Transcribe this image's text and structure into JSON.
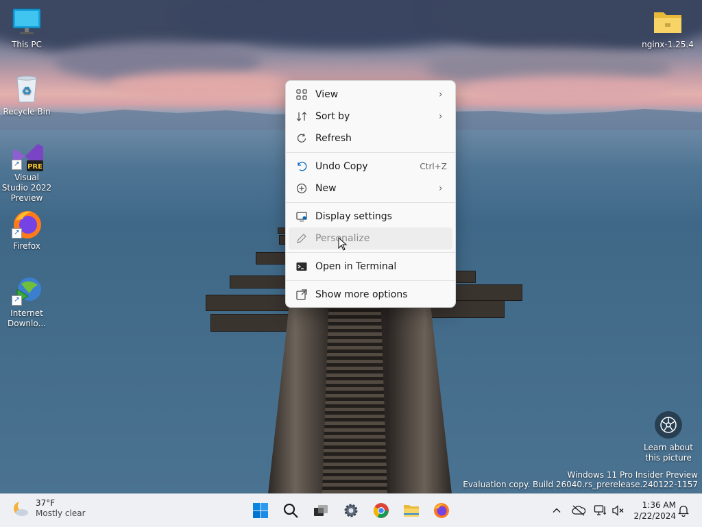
{
  "desktop": {
    "icons": [
      {
        "label": "This PC"
      },
      {
        "label": "Recycle Bin"
      },
      {
        "label": "Visual Studio 2022 Preview",
        "badge": "PRE"
      },
      {
        "label": "Firefox"
      },
      {
        "label": "Internet Downlo..."
      },
      {
        "label": "nginx-1.25.4"
      }
    ],
    "learn_picture": "Learn about this picture",
    "watermark": {
      "line1": "Windows 11 Pro Insider Preview",
      "line2": "Evaluation copy. Build 26040.rs_prerelease.240122-1157"
    }
  },
  "context_menu": {
    "items": [
      {
        "label": "View",
        "icon": "grid-icon",
        "submenu": true
      },
      {
        "label": "Sort by",
        "icon": "sort-icon",
        "submenu": true
      },
      {
        "label": "Refresh",
        "icon": "refresh-icon"
      },
      {
        "label": "Undo Copy",
        "icon": "undo-icon",
        "shortcut": "Ctrl+Z"
      },
      {
        "label": "New",
        "icon": "plus-circle-icon",
        "submenu": true
      },
      {
        "label": "Display settings",
        "icon": "display-icon"
      },
      {
        "label": "Personalize",
        "icon": "pen-icon",
        "state": "hover"
      },
      {
        "label": "Open in Terminal",
        "icon": "terminal-icon"
      },
      {
        "label": "Show more options",
        "icon": "expand-icon"
      }
    ]
  },
  "taskbar": {
    "weather": {
      "temp": "37°F",
      "condition": "Mostly clear"
    },
    "apps": [
      "start-icon",
      "search-icon",
      "task-view-icon",
      "settings-icon",
      "chrome-icon",
      "file-explorer-icon",
      "firefox-icon"
    ],
    "tray": [
      "chevron-up-icon",
      "onedrive-offline-icon",
      "network-icon",
      "volume-muted-icon"
    ],
    "clock": {
      "time": "1:36 AM",
      "date": "2/22/2024"
    }
  },
  "colors": {
    "accent": "#0067c0",
    "menu_bg": "#f9f9f9",
    "taskbar_bg": "#eef0f4"
  }
}
